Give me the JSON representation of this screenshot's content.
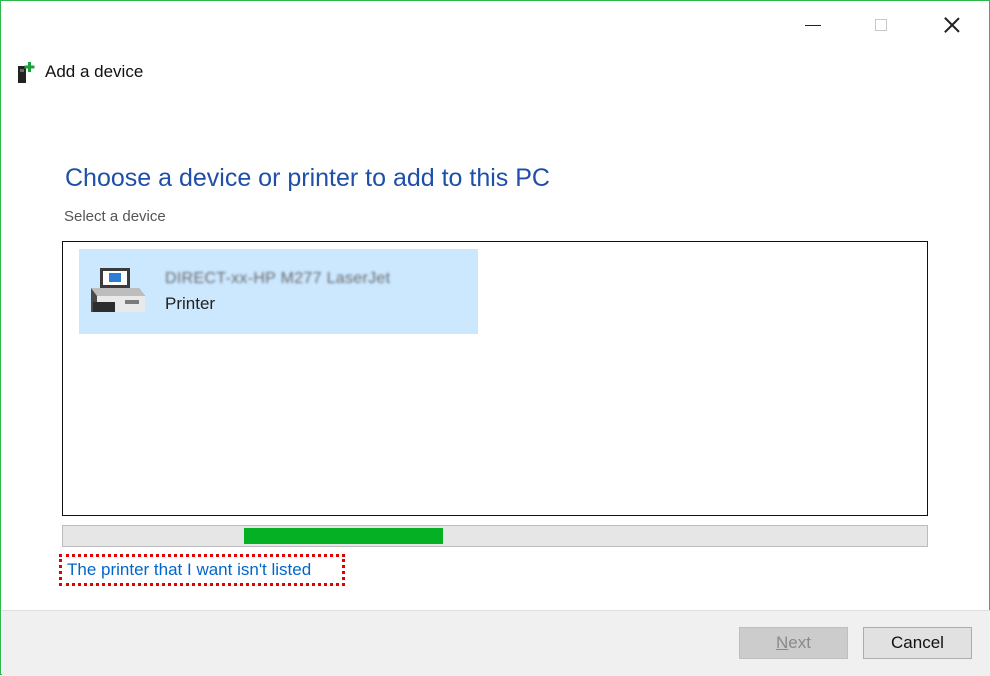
{
  "window": {
    "title": "Add a device",
    "controls": {
      "minimize": "minimize-icon",
      "maximize": "maximize-icon",
      "close": "close-icon"
    }
  },
  "main": {
    "heading": "Choose a device or printer to add to this PC",
    "subheading": "Select a device",
    "devices": [
      {
        "name": "DIRECT-xx-HP M277 LaserJet",
        "type": "Printer",
        "icon": "printer-icon",
        "selected": true
      }
    ],
    "progress": {
      "fill_fraction": 0.23,
      "offset_fraction": 0.21,
      "color": "#06b025"
    },
    "not_listed_link": "The printer that I want isn't listed"
  },
  "footer": {
    "next_first": "N",
    "next_rest": "ext",
    "cancel": "Cancel"
  },
  "colors": {
    "accent": "#1f4fa8",
    "link": "#0066cc",
    "selection": "#cce8ff",
    "border": "#2db84d",
    "highlight": "#e00000"
  }
}
